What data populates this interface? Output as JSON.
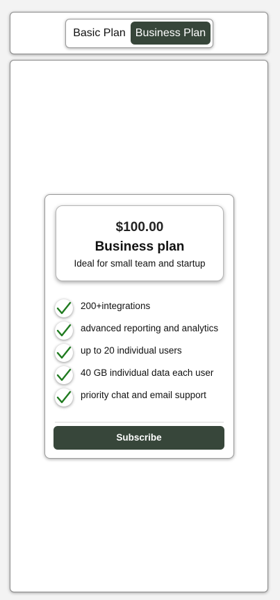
{
  "plan_toggle": {
    "basic_label": "Basic Plan",
    "business_label": "Business Plan",
    "active": "Business Plan"
  },
  "plan_card": {
    "price": "$100.00",
    "name": "Business plan",
    "description": "Ideal for small team and startup",
    "features": [
      "200+integrations",
      "advanced reporting and analytics",
      "up to 20 individual users",
      "40 GB individual data each user",
      "priority chat and email support"
    ],
    "subscribe_label": "Subscribe"
  },
  "colors": {
    "accent": "#37463a",
    "check": "#1f7a1f"
  }
}
